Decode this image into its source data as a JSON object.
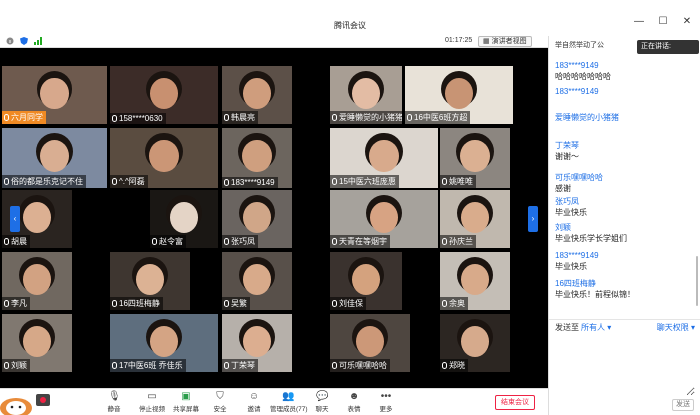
{
  "window": {
    "title": "腾讯会议",
    "minimize": "—",
    "maximize": "☐",
    "close": "✕"
  },
  "status": {
    "timer": "01:17:25",
    "gallery_label": "演讲者视图"
  },
  "tiles": [
    {
      "name": "六月同学",
      "bg": "#6e5a4e",
      "skin": "#d7a88c",
      "muted": true
    },
    {
      "name": "158****0630",
      "bg": "#3c2c28",
      "skin": "#c89070",
      "muted": false
    },
    {
      "name": "韩晨亮",
      "bg": "#5c5048",
      "skin": "#cf9d7d",
      "muted": false
    },
    {
      "name": "爱睡懒觉的小猪猪",
      "bg": "#a89e94",
      "skin": "#e3bca4",
      "muted": false
    },
    {
      "name": "16中医6班方超",
      "bg": "#e8e2d8",
      "skin": "#c89474",
      "muted": false
    },
    {
      "name": "俗的都是乐克记不住",
      "bg": "#7d8aa0",
      "skin": "#d9ae92",
      "muted": false
    },
    {
      "name": "^.^阿磊",
      "bg": "#5a4c40",
      "skin": "#cb9676",
      "muted": false
    },
    {
      "name": "183****9149",
      "bg": "#6c655e",
      "skin": "#cf9f7f",
      "muted": false
    },
    {
      "name": "15中医六班庞惠",
      "bg": "#dcd6cf",
      "skin": "#d8aa8c",
      "muted": false
    },
    {
      "name": "姚唯唯",
      "bg": "#8c8680",
      "skin": "#dbb092",
      "muted": false
    },
    {
      "name": "胡晨",
      "bg": "#2a2420",
      "skin": "#dcb092",
      "muted": false
    },
    {
      "name": "赵令富",
      "bg": "#1a1714",
      "skin": "#e4d4c6",
      "muted": false
    },
    {
      "name": "张巧凤",
      "bg": "#6a6460",
      "skin": "#d0a688",
      "muted": false
    },
    {
      "name": "天青在等烟宇",
      "bg": "#a6a29c",
      "skin": "#d7a383",
      "muted": false
    },
    {
      "name": "孙庆兰",
      "bg": "#c0b8ae",
      "skin": "#d9ac8c",
      "muted": false
    },
    {
      "name": "李凡",
      "bg": "#706860",
      "skin": "#d2a282",
      "muted": false
    },
    {
      "name": "16四班梅静",
      "bg": "#3e3630",
      "skin": "#dcb294",
      "muted": false
    },
    {
      "name": "吴繁",
      "bg": "#58504a",
      "skin": "#d8aa8a",
      "muted": false
    },
    {
      "name": "刘佳保",
      "bg": "#3a322e",
      "skin": "#d4a27e",
      "muted": false
    },
    {
      "name": "余奥",
      "bg": "#c4beb6",
      "skin": "#d8aa8a",
      "muted": false
    },
    {
      "name": "刘颖",
      "bg": "#807870",
      "skin": "#d6a888",
      "muted": false
    },
    {
      "name": "17中医6班 乔佳乐",
      "bg": "#5e6e7e",
      "skin": "#d4a484",
      "muted": false
    },
    {
      "name": "丁荣琴",
      "bg": "#b6b0aa",
      "skin": "#dcae90",
      "muted": false
    },
    {
      "name": "可乐嘿嘿哈哈",
      "bg": "#4e4640",
      "skin": "#cc9878",
      "muted": false
    },
    {
      "name": "郑晓",
      "bg": "#2c2622",
      "skin": "#d6aa8c",
      "muted": false
    }
  ],
  "toolbar": {
    "mic": "静音",
    "video": "停止视频",
    "share": "共享屏幕",
    "security": "安全",
    "invite": "邀请",
    "participants": "管理成员(77)",
    "chat": "聊天",
    "reactions": "表情",
    "more": "更多",
    "end": "结束会议"
  },
  "chat": {
    "speaking_tip": "正在讲话:",
    "partial_top": "举自然举动了公",
    "messages": [
      {
        "sender": "183****9149",
        "text": "哈哈哈哈哈哈哈"
      },
      {
        "sender": "183****9149",
        "text": ""
      },
      {
        "sender": "爱睡懒觉的小猪猪",
        "text": ""
      },
      {
        "sender": "丁荣琴",
        "text": "谢谢～"
      },
      {
        "sender": "可乐嘿嘿哈哈",
        "text": "感谢"
      },
      {
        "sender": "张巧凤",
        "text": "毕业快乐"
      },
      {
        "sender": "刘颖",
        "text": "毕业快乐学长学姐们"
      },
      {
        "sender": "183****9149",
        "text": "毕业快乐"
      },
      {
        "sender": "16四班梅静",
        "text": "毕业快乐！前程似锦！"
      }
    ],
    "send_to_label": "发送至",
    "send_to_target": "所有人 ▾",
    "permission": "聊天权限 ▾",
    "send_button": "发送"
  }
}
